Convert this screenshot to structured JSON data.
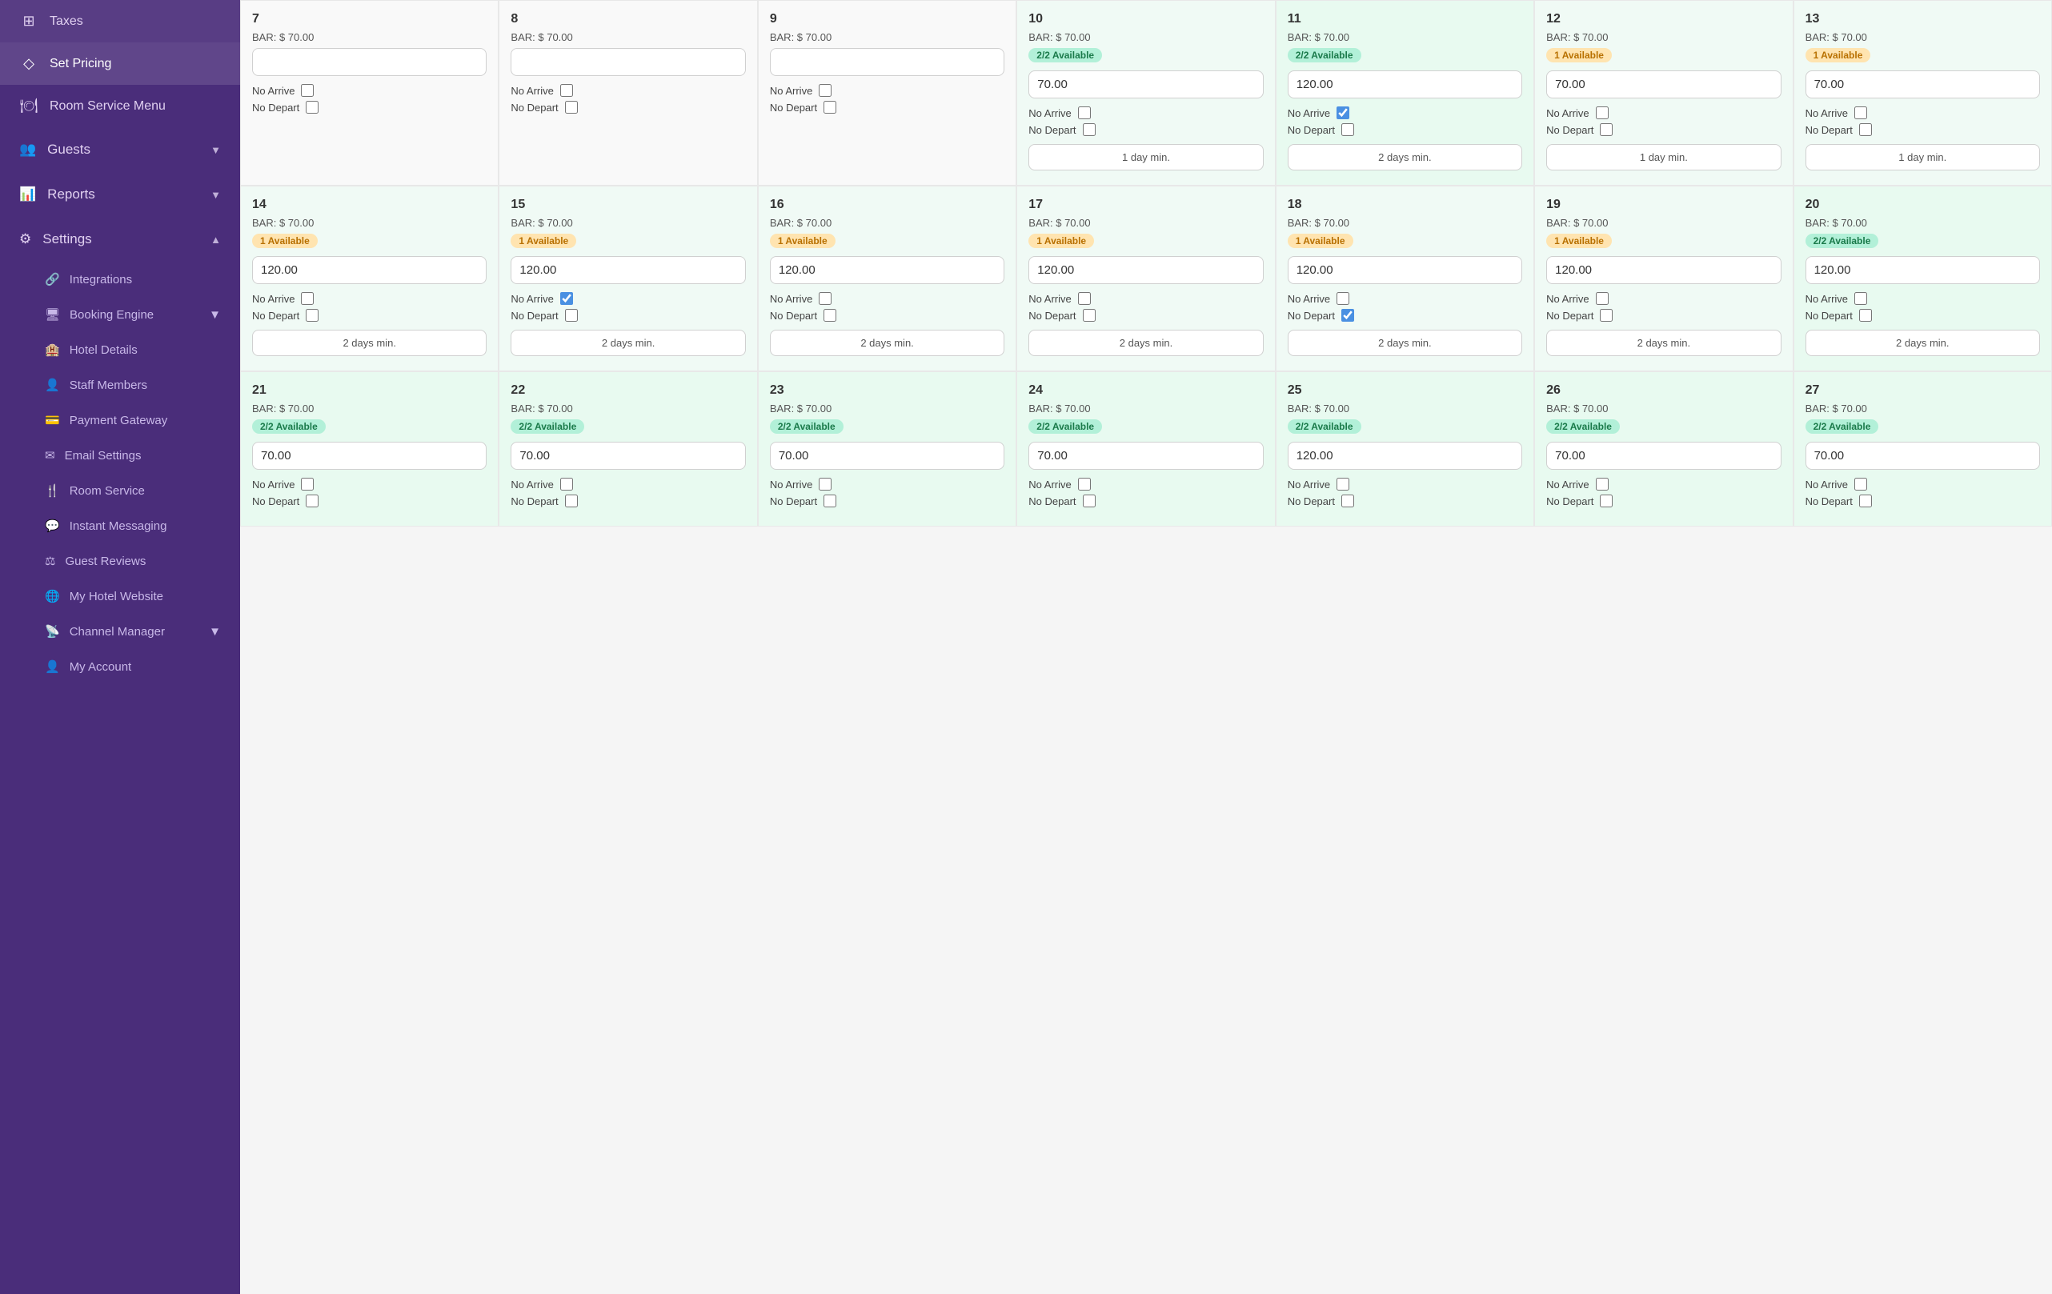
{
  "sidebar": {
    "items": [
      {
        "id": "taxes",
        "label": "Taxes",
        "icon": "⊞",
        "interactable": true
      },
      {
        "id": "set-pricing",
        "label": "Set Pricing",
        "icon": "◇",
        "interactable": true,
        "active": true
      },
      {
        "id": "room-service-menu",
        "label": "Room Service Menu",
        "icon": "🍽",
        "interactable": true
      }
    ],
    "sections": [
      {
        "id": "guests",
        "label": "Guests",
        "icon": "👥",
        "expanded": false
      },
      {
        "id": "reports",
        "label": "Reports",
        "icon": "📊",
        "expanded": false
      },
      {
        "id": "settings",
        "label": "Settings",
        "icon": "⚙",
        "expanded": true
      }
    ],
    "settings_sub": [
      {
        "id": "integrations",
        "label": "Integrations",
        "icon": "🔗"
      },
      {
        "id": "booking-engine",
        "label": "Booking Engine",
        "icon": "🖥",
        "has_chevron": true
      },
      {
        "id": "hotel-details",
        "label": "Hotel Details",
        "icon": "🏨"
      },
      {
        "id": "staff-members",
        "label": "Staff Members",
        "icon": "👤"
      },
      {
        "id": "payment-gateway",
        "label": "Payment Gateway",
        "icon": "💳"
      },
      {
        "id": "email-settings",
        "label": "Email Settings",
        "icon": "✉"
      },
      {
        "id": "room-service",
        "label": "Room Service",
        "icon": "🍴"
      },
      {
        "id": "instant-messaging",
        "label": "Instant Messaging",
        "icon": "💬"
      },
      {
        "id": "guest-reviews",
        "label": "Guest Reviews",
        "icon": "⚖"
      },
      {
        "id": "my-hotel-website",
        "label": "My Hotel Website",
        "icon": "🌐"
      },
      {
        "id": "channel-manager",
        "label": "Channel Manager",
        "icon": "📡",
        "has_chevron": true
      }
    ],
    "bottom": [
      {
        "id": "my-account",
        "label": "My Account",
        "icon": "👤"
      }
    ]
  },
  "calendar": {
    "rows": [
      {
        "days": [
          {
            "num": 7,
            "bar": "$ 70.00",
            "badge": null,
            "price": "",
            "no_arrive": false,
            "no_depart": false,
            "min_days": null,
            "bg": "empty"
          },
          {
            "num": 8,
            "bar": "$ 70.00",
            "badge": null,
            "price": "",
            "no_arrive": false,
            "no_depart": false,
            "min_days": null,
            "bg": "empty"
          },
          {
            "num": 9,
            "bar": "$ 70.00",
            "badge": null,
            "price": "",
            "no_arrive": false,
            "no_depart": false,
            "min_days": null,
            "bg": "empty"
          },
          {
            "num": 10,
            "bar": "$ 70.00",
            "badge": "2/2 Available",
            "badge_type": "green",
            "price": "70.00",
            "no_arrive": false,
            "no_depart": false,
            "min_days": "1 day min.",
            "bg": "light"
          },
          {
            "num": 11,
            "bar": "$ 70.00",
            "badge": "2/2 Available",
            "badge_type": "green",
            "price": "120.00",
            "no_arrive": true,
            "no_depart": false,
            "min_days": "2 days min.",
            "bg": "green"
          },
          {
            "num": 12,
            "bar": "$ 70.00",
            "badge": "1 Available",
            "badge_type": "orange",
            "price": "70.00",
            "no_arrive": false,
            "no_depart": false,
            "min_days": "1 day min.",
            "bg": "light"
          },
          {
            "num": 13,
            "bar": "$ 70.00",
            "badge": "1 Available",
            "badge_type": "orange",
            "price": "70.00",
            "no_arrive": false,
            "no_depart": false,
            "min_days": "1 day min.",
            "bg": "light"
          }
        ]
      },
      {
        "days": [
          {
            "num": 14,
            "bar": "$ 70.00",
            "badge": "1 Available",
            "badge_type": "orange",
            "price": "120.00",
            "no_arrive": false,
            "no_depart": false,
            "min_days": "2 days min.",
            "bg": "light"
          },
          {
            "num": 15,
            "bar": "$ 70.00",
            "badge": "1 Available",
            "badge_type": "orange",
            "price": "120.00",
            "no_arrive": true,
            "no_depart": false,
            "min_days": "2 days min.",
            "bg": "light"
          },
          {
            "num": 16,
            "bar": "$ 70.00",
            "badge": "1 Available",
            "badge_type": "orange",
            "price": "120.00",
            "no_arrive": false,
            "no_depart": false,
            "min_days": "2 days min.",
            "bg": "light"
          },
          {
            "num": 17,
            "bar": "$ 70.00",
            "badge": "1 Available",
            "badge_type": "orange",
            "price": "120.00",
            "no_arrive": false,
            "no_depart": false,
            "min_days": "2 days min.",
            "bg": "light"
          },
          {
            "num": 18,
            "bar": "$ 70.00",
            "badge": "1 Available",
            "badge_type": "orange",
            "price": "120.00",
            "no_arrive": false,
            "no_depart": true,
            "min_days": "2 days min.",
            "bg": "light"
          },
          {
            "num": 19,
            "bar": "$ 70.00",
            "badge": "1 Available",
            "badge_type": "orange",
            "price": "120.00",
            "no_arrive": false,
            "no_depart": false,
            "min_days": "2 days min.",
            "bg": "light"
          },
          {
            "num": 20,
            "bar": "$ 70.00",
            "badge": "2/2 Available",
            "badge_type": "green",
            "price": "120.00",
            "no_arrive": false,
            "no_depart": false,
            "min_days": "2 days min.",
            "bg": "green"
          }
        ]
      },
      {
        "days": [
          {
            "num": 21,
            "bar": "$ 70.00",
            "badge": "2/2 Available",
            "badge_type": "green",
            "price": "70.00",
            "no_arrive": false,
            "no_depart": false,
            "min_days": null,
            "bg": "green"
          },
          {
            "num": 22,
            "bar": "$ 70.00",
            "badge": "2/2 Available",
            "badge_type": "green",
            "price": "70.00",
            "no_arrive": false,
            "no_depart": false,
            "min_days": null,
            "bg": "green"
          },
          {
            "num": 23,
            "bar": "$ 70.00",
            "badge": "2/2 Available",
            "badge_type": "green",
            "price": "70.00",
            "no_arrive": false,
            "no_depart": false,
            "min_days": null,
            "bg": "green"
          },
          {
            "num": 24,
            "bar": "$ 70.00",
            "badge": "2/2 Available",
            "badge_type": "green",
            "price": "70.00",
            "no_arrive": false,
            "no_depart": false,
            "min_days": null,
            "bg": "green"
          },
          {
            "num": 25,
            "bar": "$ 70.00",
            "badge": "2/2 Available",
            "badge_type": "green",
            "price": "120.00",
            "no_arrive": false,
            "no_depart": false,
            "min_days": null,
            "bg": "green"
          },
          {
            "num": 26,
            "bar": "$ 70.00",
            "badge": "2/2 Available",
            "badge_type": "green",
            "price": "70.00",
            "no_arrive": false,
            "no_depart": false,
            "min_days": null,
            "bg": "green"
          },
          {
            "num": 27,
            "bar": "$ 70.00",
            "badge": "2/2 Available",
            "badge_type": "green",
            "price": "70.00",
            "no_arrive": false,
            "no_depart": false,
            "min_days": null,
            "bg": "green"
          }
        ]
      }
    ],
    "no_arrive_label": "No Arrive",
    "no_depart_label": "No Depart",
    "bar_prefix": "BAR:"
  }
}
